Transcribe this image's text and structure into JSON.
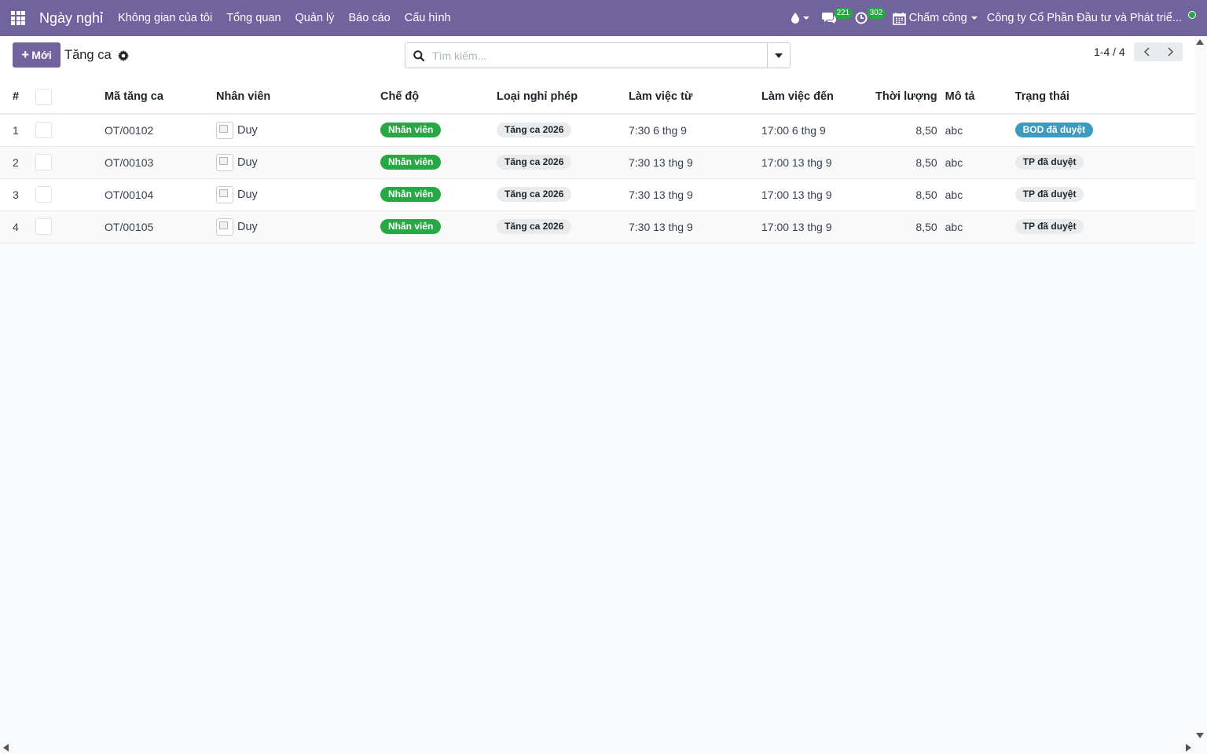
{
  "topbar": {
    "app_title": "Ngày nghỉ",
    "menu": [
      {
        "label": "Không gian của tôi"
      },
      {
        "label": "Tổng quan"
      },
      {
        "label": "Quản lý"
      },
      {
        "label": "Báo cáo"
      },
      {
        "label": "Cấu hình"
      }
    ],
    "messages_count": "221",
    "activities_count": "302",
    "attendance_label": "Chấm công",
    "company_name": "Công ty Cổ Phần Đầu tư và Phát triể..."
  },
  "control": {
    "new_button_label": "Mới",
    "breadcrumb": "Tăng ca",
    "search_placeholder": "Tìm kiếm...",
    "pager_text": "1-4 / 4"
  },
  "table": {
    "columns": {
      "num": "#",
      "code": "Mã tăng ca",
      "employee": "Nhân viên",
      "mode": "Chế độ",
      "leave_type": "Loại nghỉ phép",
      "from": "Làm việc từ",
      "to": "Làm việc đến",
      "duration": "Thời lượng",
      "description": "Mô tả",
      "state": "Trạng thái"
    },
    "rows": [
      {
        "num": "1",
        "code": "OT/00102",
        "employee": "Duy",
        "mode": "Nhân viên",
        "leave_type": "Tăng ca 2026",
        "from": "7:30 6 thg 9",
        "to": "17:00 6 thg 9",
        "duration": "8,50",
        "description": "abc",
        "state": "BOD đã duyệt",
        "state_color": "#3c9bbf"
      },
      {
        "num": "2",
        "code": "OT/00103",
        "employee": "Duy",
        "mode": "Nhân viên",
        "leave_type": "Tăng ca 2026",
        "from": "7:30 13 thg 9",
        "to": "17:00 13 thg 9",
        "duration": "8,50",
        "description": "abc",
        "state": "TP đã duyệt",
        "state_color": "#e9ecef"
      },
      {
        "num": "3",
        "code": "OT/00104",
        "employee": "Duy",
        "mode": "Nhân viên",
        "leave_type": "Tăng ca 2026",
        "from": "7:30 13 thg 9",
        "to": "17:00 13 thg 9",
        "duration": "8,50",
        "description": "abc",
        "state": "TP đã duyệt",
        "state_color": "#e9ecef"
      },
      {
        "num": "4",
        "code": "OT/00105",
        "employee": "Duy",
        "mode": "Nhân viên",
        "leave_type": "Tăng ca 2026",
        "from": "7:30 13 thg 9",
        "to": "17:00 13 thg 9",
        "duration": "8,50",
        "description": "abc",
        "state": "TP đã duyệt",
        "state_color": "#e9ecef"
      }
    ]
  },
  "colors": {
    "brand": "#71639e",
    "mode_badge": "#28a745",
    "bod_badge": "#3c9bbf",
    "online": "#28a745"
  }
}
